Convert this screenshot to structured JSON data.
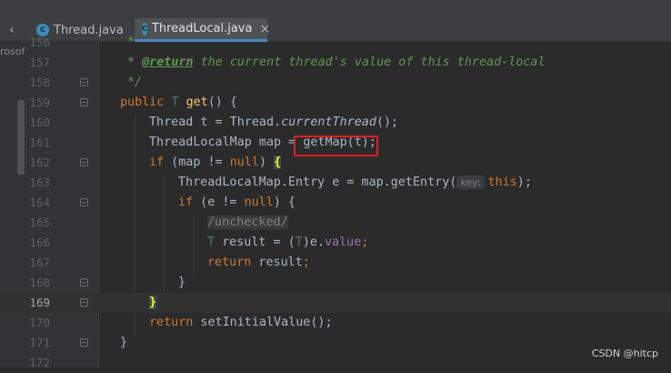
{
  "tabs": [
    {
      "label": "Thread.java",
      "icon": "c",
      "active": false
    },
    {
      "label": "ThreadLocal.java",
      "icon": "c",
      "active": true
    }
  ],
  "left_panel_text": "rosof",
  "lines": [
    {
      "num": "156"
    },
    {
      "num": "157"
    },
    {
      "num": "158"
    },
    {
      "num": "159"
    },
    {
      "num": "160"
    },
    {
      "num": "161"
    },
    {
      "num": "162"
    },
    {
      "num": "163"
    },
    {
      "num": "164"
    },
    {
      "num": "165"
    },
    {
      "num": "166"
    },
    {
      "num": "167"
    },
    {
      "num": "168"
    },
    {
      "num": "169"
    },
    {
      "num": "170"
    },
    {
      "num": "171"
    },
    {
      "num": "172"
    }
  ],
  "code": {
    "l156": "*",
    "l157_tag": "@return",
    "l157_text": " the current thread's value of this thread-local",
    "l158": "*/",
    "l159_public": "public",
    "l159_T": "T",
    "l159_get": "get",
    "l159_rest": "() {",
    "l160_a": "Thread t = Thread.",
    "l160_call": "currentThread",
    "l160_b": "();",
    "l161_a": "ThreadLocalMap map = ",
    "l161_b": "getMap(t);",
    "l162_if": "if",
    "l162_a": " (map != ",
    "l162_null": "null",
    "l162_b": ") ",
    "l162_brace": "{",
    "l163_a": "ThreadLocalMap.Entry e = map.getEntry(",
    "l163_hint": "key:",
    "l163_this": "this",
    "l163_b": ");",
    "l164_if": "if",
    "l164_a": " (e != ",
    "l164_null": "null",
    "l164_b": ") {",
    "l165": "/unchecked/",
    "l166_T": "T",
    "l166_a": " result = (",
    "l166_T2": "T",
    "l166_b": ")e.",
    "l166_value": "value",
    "l166_semi": ";",
    "l167_return": "return",
    "l167_a": " result",
    "l167_semi": ";",
    "l168": "}",
    "l169_brace": "}",
    "l170_return": "return",
    "l170_a": " setInitialValue();",
    "l171": "}"
  },
  "active_line": "169",
  "watermark": "CSDN @hitcp",
  "colors": {
    "background": "#2b2b2b",
    "keyword": "#cc7832",
    "comment": "#629755",
    "method": "#ffc66d",
    "field": "#9876aa",
    "highlight_box": "#e02020",
    "active_tab_underline": "#4a88c7"
  }
}
